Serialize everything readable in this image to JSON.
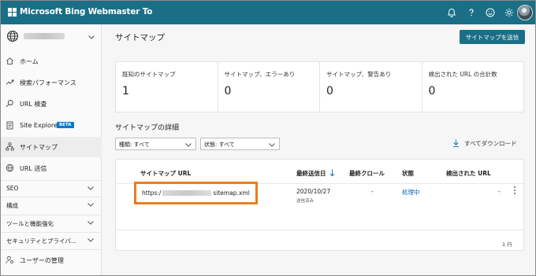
{
  "app": {
    "title": "Microsoft Bing Webmaster To"
  },
  "topbar_icons": [
    "bell-icon",
    "help-icon",
    "smiley-icon",
    "gear-icon"
  ],
  "sidebar": {
    "items": [
      {
        "label": "ホーム",
        "icon": "home-icon"
      },
      {
        "label": "検索パフォーマンス",
        "icon": "trend-icon"
      },
      {
        "label": "URL 検査",
        "icon": "search-icon"
      },
      {
        "label": "Site Explorer",
        "icon": "document-icon",
        "badge": "BETA"
      },
      {
        "label": "サイトマップ",
        "icon": "sitemap-icon",
        "active": true
      },
      {
        "label": "URL 送信",
        "icon": "globe-icon"
      }
    ],
    "sections": [
      {
        "label": "SEO"
      },
      {
        "label": "構成"
      },
      {
        "label": "ツールと機能強化"
      },
      {
        "label": "セキュリティとプライバ..."
      }
    ],
    "bottom_item": {
      "label": "ユーザーの管理",
      "icon": "user-settings-icon"
    }
  },
  "main": {
    "page_title": "サイトマップ",
    "submit_button": "サイトマップを送信",
    "stats": [
      {
        "label": "既知のサイトマップ",
        "value": "1"
      },
      {
        "label": "サイトマップ、エラーあり",
        "value": "0"
      },
      {
        "label": "サイトマップ、警告あり",
        "value": "0"
      },
      {
        "label": "検出された URL の合計数",
        "value": "0"
      }
    ],
    "details_title": "サイトマップの詳細",
    "filters": {
      "type": "種類: すべて",
      "status": "状態: すべて"
    },
    "download_all": "すべてダウンロード",
    "table": {
      "columns": [
        "サイトマップ URL",
        "最終送信日",
        "最終クロール",
        "状態",
        "検出された URL"
      ],
      "rows": [
        {
          "url_prefix": "https:/",
          "url_suffix": "sitemap.xml",
          "submitted_date": "2020/10/27",
          "submitted_note": "送信済み",
          "last_crawl": "-",
          "status": "処理中",
          "discovered_urls": "-"
        }
      ],
      "row_count": "1 行"
    }
  },
  "colors": {
    "topbar": "#1a6f87",
    "accent_button": "#1a6f87",
    "link": "#0067b8",
    "highlight_box": "#ed7d1a",
    "beta_badge": "#0078d4"
  }
}
